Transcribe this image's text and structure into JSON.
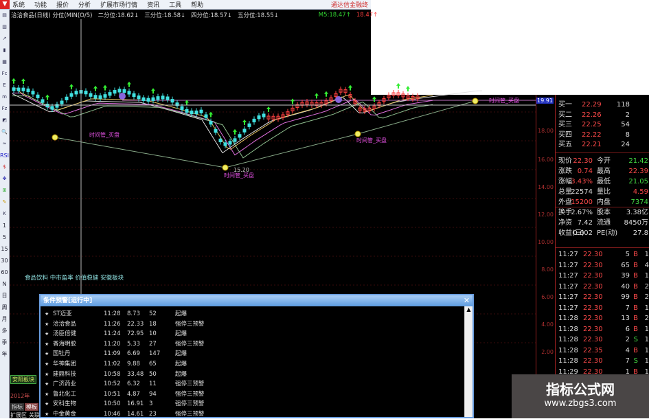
{
  "menu": {
    "items": [
      "系统",
      "功能",
      "报价",
      "分析",
      "扩展市场行情",
      "资讯",
      "工具",
      "帮助"
    ],
    "brand": "通达信金融终"
  },
  "header": {
    "title": "洽洽食品(日线) 分位(MIN(O/5)",
    "q2": "二分位:18.62↓",
    "q3": "三分位:18.58↓",
    "q4": "四分位:18.57↓",
    "q5": "五分位:18.55↓",
    "m5": "M5:18.47↑",
    "m5b": "18.47↑"
  },
  "sidebar": {
    "items": [
      "RSI",
      "1",
      "5",
      "15",
      "30",
      "60",
      "N",
      "日",
      "周",
      "月",
      "多",
      "季",
      "年"
    ]
  },
  "chart": {
    "annotations": [
      "时间管_买盘",
      "时间管_买盘",
      "时间管_买盘",
      "时间管_买盘"
    ],
    "low_label": "15.20",
    "axis": [
      "19.91",
      "18.00",
      "16.00",
      "14.00",
      "12.00",
      "10.00",
      "8.00",
      "6.00",
      "4.00",
      "2.00"
    ],
    "colors": {
      "up": "#ff4040",
      "down": "#40e0e0",
      "signal": "#33ee33",
      "ma1": "#e0e0e0",
      "ma2": "#e070e0",
      "ma3": "#e0c060",
      "ma4": "#90c090"
    }
  },
  "sector_tags": "食品饮料 中市盈率 价值稳健 安徽板块",
  "orderbook": [
    {
      "label": "买一",
      "price": "22.29",
      "vol": "118"
    },
    {
      "label": "买二",
      "price": "22.26",
      "vol": "2"
    },
    {
      "label": "买三",
      "price": "22.25",
      "vol": "54"
    },
    {
      "label": "买四",
      "price": "22.22",
      "vol": "8"
    },
    {
      "label": "买五",
      "price": "22.21",
      "vol": "24"
    }
  ],
  "quote": [
    {
      "l1": "现价",
      "v1": "22.30",
      "l2": "今开",
      "v2": "21.42"
    },
    {
      "l1": "涨跌",
      "v1": "0.74",
      "l2": "最高",
      "v2": "22.39"
    },
    {
      "l1": "涨幅",
      "v1": "3.43%",
      "l2": "最低",
      "v2": "21.05"
    },
    {
      "l1": "总量",
      "v1": "22574",
      "l2": "量比",
      "v2": "4.59"
    },
    {
      "l1": "外盘",
      "v1": "15200",
      "l2": "内盘",
      "v2": "7374"
    },
    {
      "l1": "换手",
      "v1": "2.67%",
      "l2": "股本",
      "v2": "3.38亿"
    },
    {
      "l1": "净资",
      "v1": "7.42",
      "l2": "流通",
      "v2": "8450万"
    },
    {
      "l1": "收益(三)",
      "v1": "0.602",
      "l2": "PE(动)",
      "v2": "27.8"
    }
  ],
  "trades": [
    {
      "t": "11:27",
      "p": "22.30",
      "v": "5",
      "s": "B",
      "n": "1"
    },
    {
      "t": "11:27",
      "p": "22.30",
      "v": "65",
      "s": "B",
      "n": "4"
    },
    {
      "t": "11:27",
      "p": "22.30",
      "v": "39",
      "s": "B",
      "n": "1"
    },
    {
      "t": "11:27",
      "p": "22.30",
      "v": "40",
      "s": "B",
      "n": "2"
    },
    {
      "t": "11:27",
      "p": "22.30",
      "v": "99",
      "s": "B",
      "n": "2"
    },
    {
      "t": "11:27",
      "p": "22.30",
      "v": "7",
      "s": "B",
      "n": "1"
    },
    {
      "t": "11:28",
      "p": "22.30",
      "v": "13",
      "s": "B",
      "n": "2"
    },
    {
      "t": "11:28",
      "p": "22.30",
      "v": "6",
      "s": "B",
      "n": "1"
    },
    {
      "t": "11:28",
      "p": "22.30",
      "v": "2",
      "s": "S",
      "n": "1"
    },
    {
      "t": "11:28",
      "p": "22.35",
      "v": "4",
      "s": "B",
      "n": "1"
    },
    {
      "t": "11:28",
      "p": "22.30",
      "v": "7",
      "s": "S",
      "n": "1"
    },
    {
      "t": "11:29",
      "p": "22.30",
      "v": "1",
      "s": "B",
      "n": "1"
    }
  ],
  "popup": {
    "title": "条件预警[运行中]",
    "rows": [
      {
        "name": "ST迈亚",
        "time": "11:28",
        "price": "8.73",
        "num": "52",
        "signal": "起爆"
      },
      {
        "name": "洽洽食品",
        "time": "11:26",
        "price": "22.33",
        "num": "18",
        "signal": "强停三预警"
      },
      {
        "name": "汤臣倍健",
        "time": "11:24",
        "price": "72.95",
        "num": "10",
        "signal": "起爆"
      },
      {
        "name": "香海明胶",
        "time": "11:20",
        "price": "5.33",
        "num": "27",
        "signal": "强停三预警"
      },
      {
        "name": "国牡丹",
        "time": "11:09",
        "price": "6.69",
        "num": "147",
        "signal": "起爆"
      },
      {
        "name": "华神集团",
        "time": "11:02",
        "price": "9.88",
        "num": "65",
        "signal": "起爆"
      },
      {
        "name": "建鼎科技",
        "time": "10:58",
        "price": "33.48",
        "num": "50",
        "signal": "起爆"
      },
      {
        "name": "广济药业",
        "time": "10:52",
        "price": "6.32",
        "num": "11",
        "signal": "强停三预警"
      },
      {
        "name": "鲁北化工",
        "time": "10:51",
        "price": "4.87",
        "num": "94",
        "signal": "强停三预警"
      },
      {
        "name": "安科生物",
        "time": "10:50",
        "price": "16.91",
        "num": "3",
        "signal": "强停三预警"
      },
      {
        "name": "中金黄金",
        "time": "10:46",
        "price": "14.61",
        "num": "23",
        "signal": "强停三预警"
      }
    ]
  },
  "bottom": {
    "tag": "安阳板块",
    "year": "2012年",
    "tab1": "指标",
    "tab2": "模板",
    "tab3": "扩展区",
    "tab4": "关联"
  },
  "watermark": {
    "title": "指标公式网",
    "url": "www.zbgs3.com"
  }
}
